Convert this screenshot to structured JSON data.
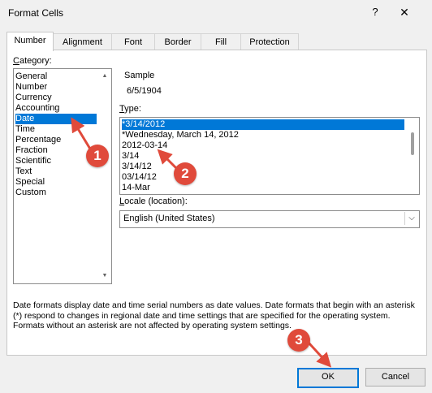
{
  "window": {
    "title": "Format Cells",
    "help_glyph": "?",
    "close_glyph": "✕"
  },
  "tabs": [
    {
      "label": "Number",
      "active": true
    },
    {
      "label": "Alignment",
      "active": false
    },
    {
      "label": "Font",
      "active": false
    },
    {
      "label": "Border",
      "active": false
    },
    {
      "label": "Fill",
      "active": false
    },
    {
      "label": "Protection",
      "active": false
    }
  ],
  "category": {
    "label_first": "C",
    "label_rest": "ategory:",
    "items": [
      "General",
      "Number",
      "Currency",
      "Accounting",
      "Date",
      "Time",
      "Percentage",
      "Fraction",
      "Scientific",
      "Text",
      "Special",
      "Custom"
    ],
    "selected_index": 4
  },
  "sample": {
    "label": "Sample",
    "value": "6/5/1904"
  },
  "type": {
    "label_first": "T",
    "label_rest": "ype:",
    "input_value": "",
    "items": [
      "*3/14/2012",
      "*Wednesday, March 14, 2012",
      "2012-03-14",
      "3/14",
      "3/14/12",
      "03/14/12",
      "14-Mar"
    ],
    "selected_index": 0
  },
  "locale": {
    "label_first": "L",
    "label_rest": "ocale (location):",
    "selected": "English (United States)"
  },
  "description": "Date formats display date and time serial numbers as date values.  Date formats that begin with an asterisk (*) respond to changes in regional date and time settings that are specified for the operating system. Formats without an asterisk are not affected by operating system settings.",
  "buttons": {
    "ok": "OK",
    "cancel": "Cancel"
  },
  "annotations": {
    "badges": [
      "1",
      "2",
      "3"
    ],
    "color": "#e04a3b"
  },
  "colors": {
    "selection": "#0078d7"
  }
}
